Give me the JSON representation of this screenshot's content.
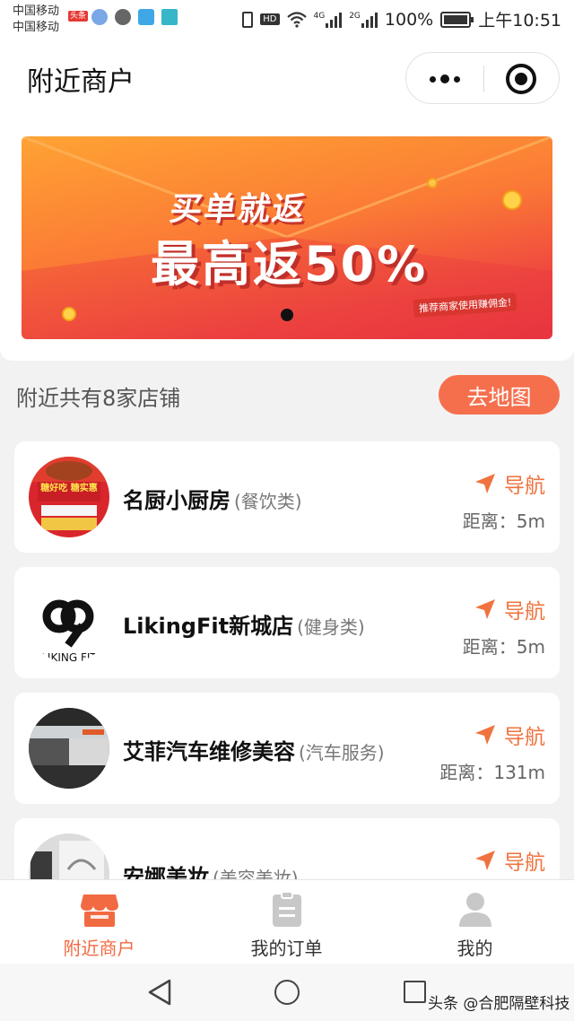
{
  "status_bar": {
    "carrier_1": "中国移动",
    "carrier_2": "中国移动",
    "badge": "头条",
    "hd": "HD",
    "net_1": "4G",
    "net_2": "2G",
    "battery": "100%",
    "time": "上午10:51"
  },
  "header": {
    "title": "附近商户",
    "more_icon": "more-dots-icon",
    "close_icon": "target-close-icon"
  },
  "banner": {
    "line1": "买单就返",
    "line2": "最高返50%",
    "tag": "推荐商家使用赚佣金!"
  },
  "list": {
    "summary": "附近共有8家店铺",
    "map_button": "去地图"
  },
  "colors": {
    "accent": "#f26a42",
    "nav_orange": "#f0733f"
  },
  "stores": [
    {
      "name": "名厨小厨房",
      "category": "(餐饮类)",
      "nav_label": "导航",
      "distance": "距离：5m",
      "avatar_text": "糖好吃 糖实惠"
    },
    {
      "name": "LikingFit新城店",
      "category": "(健身类)",
      "nav_label": "导航",
      "distance": "距离：5m",
      "logo_text": "LIKING FIT"
    },
    {
      "name": "艾菲汽车维修美容",
      "category": "(汽车服务)",
      "nav_label": "导航",
      "distance": "距离：131m"
    },
    {
      "name": "安娜美妆",
      "category": "(美容美妆)",
      "nav_label": "导航"
    }
  ],
  "tabs": [
    {
      "label": "附近商户",
      "icon": "shop-icon",
      "active": true
    },
    {
      "label": "我的订单",
      "icon": "clipboard-icon",
      "active": false
    },
    {
      "label": "我的",
      "icon": "user-icon",
      "active": false
    }
  ],
  "watermark": "头条 @合肥隔壁科技"
}
